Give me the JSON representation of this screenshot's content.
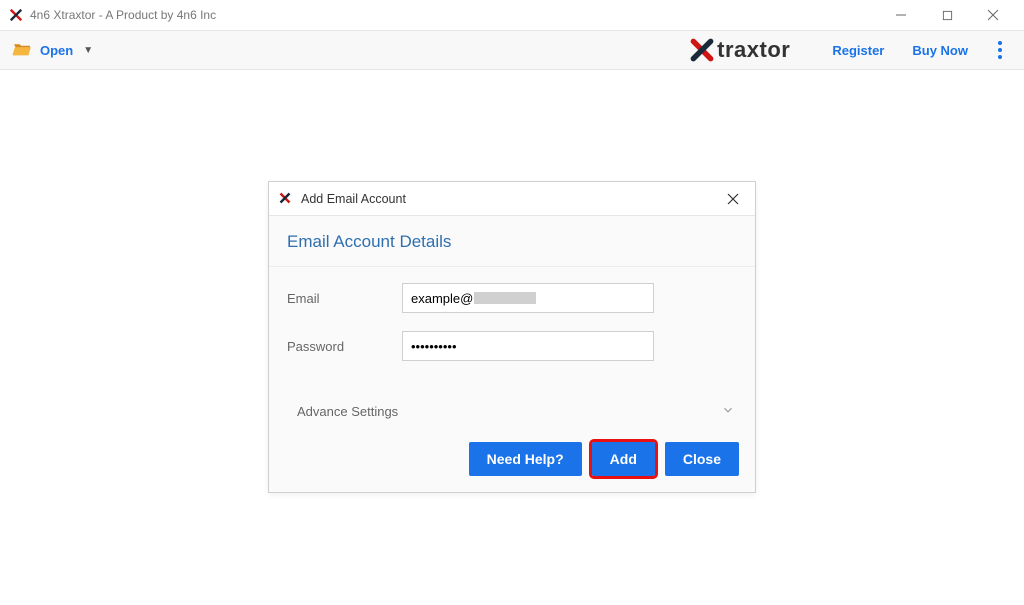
{
  "window": {
    "title": "4n6 Xtraxtor - A Product by 4n6 Inc"
  },
  "toolbar": {
    "open_label": "Open",
    "brand_text": "traxtor",
    "register_label": "Register",
    "buy_now_label": "Buy Now"
  },
  "dialog": {
    "title": "Add Email Account",
    "section_title": "Email Account Details",
    "email_label": "Email",
    "email_value": "example@",
    "password_label": "Password",
    "password_value": "••••••••••",
    "advance_label": "Advance Settings",
    "need_help_label": "Need Help?",
    "add_label": "Add",
    "close_label": "Close"
  }
}
